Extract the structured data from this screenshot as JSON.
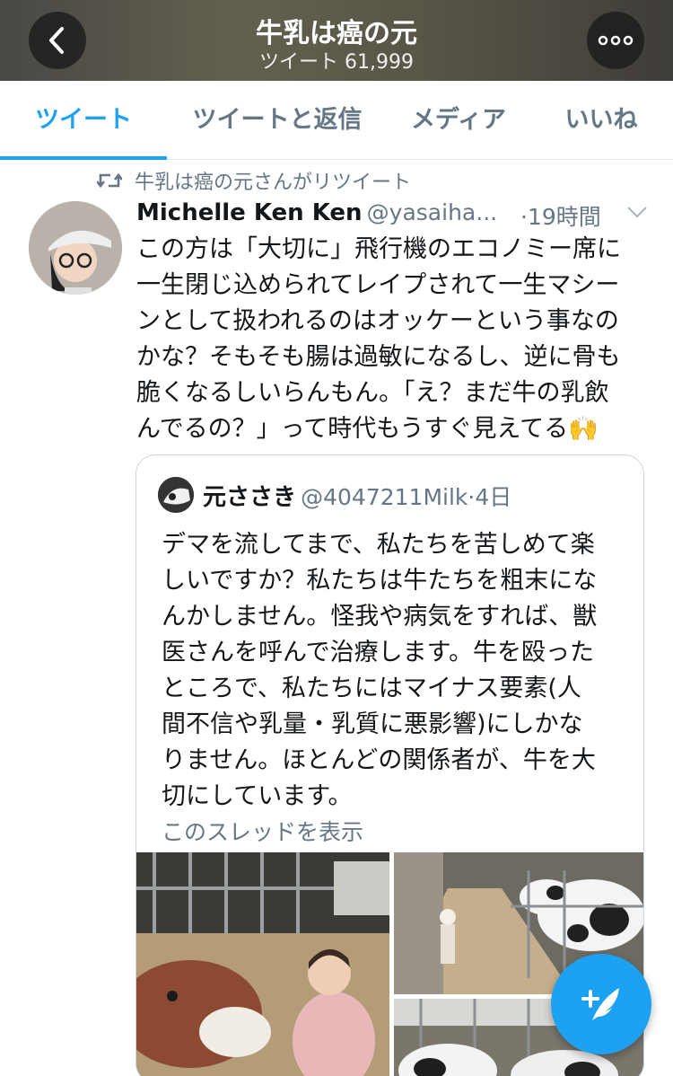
{
  "header": {
    "title": "牛乳は癌の元",
    "subtitle": "ツイート 61,999"
  },
  "tabs": [
    {
      "label": "ツイート",
      "active": true
    },
    {
      "label": "ツイートと返信",
      "active": false
    },
    {
      "label": "メディア",
      "active": false
    },
    {
      "label": "いいね",
      "active": false
    }
  ],
  "tweet": {
    "retweet_text": "牛乳は癌の元さんがリツイート",
    "author_name": "Michelle Ken Ken",
    "author_handle": "@yasaiha...",
    "time": "·19時間",
    "text_lines": [
      "この方は「大切に」飛行機のエコノミー席に",
      "一生閉じ込められてレイプされて一生マシー",
      "ンとして扱われるのはオッケーという事なの",
      "かな？そもそも腸は過敏になるし、逆に骨も",
      "脆くなるしいらんもん。「え？まだ牛の乳飲",
      "んでるの？」って時代もうすぐ見えてる🙌"
    ]
  },
  "quote": {
    "author_name": "元ささき",
    "author_handle": "@4047211Milk",
    "time": "·4日",
    "text_lines": [
      "デマを流してまで、私たちを苦しめて楽",
      "しいですか？私たちは牛たちを粗末にな",
      "んかしません。怪我や病気をすれば、獣",
      "医さんを呼んで治療します。牛を殴った",
      "ところで、私たちにはマイナス要素(人",
      "間不信や乳量・乳質に悪影響)にしかな",
      "りません。ほとんどの関係者が、牛を大",
      "切にしています。"
    ],
    "thread_link": "このスレッドを表示"
  },
  "icons": {
    "back": "chevron-left-icon",
    "more": "more-icon",
    "retweet": "retweet-icon",
    "caret": "chevron-down-icon",
    "compose": "compose-tweet-icon"
  },
  "colors": {
    "accent": "#1da1f2",
    "secondary_text": "#657786",
    "primary_text": "#14171a"
  }
}
